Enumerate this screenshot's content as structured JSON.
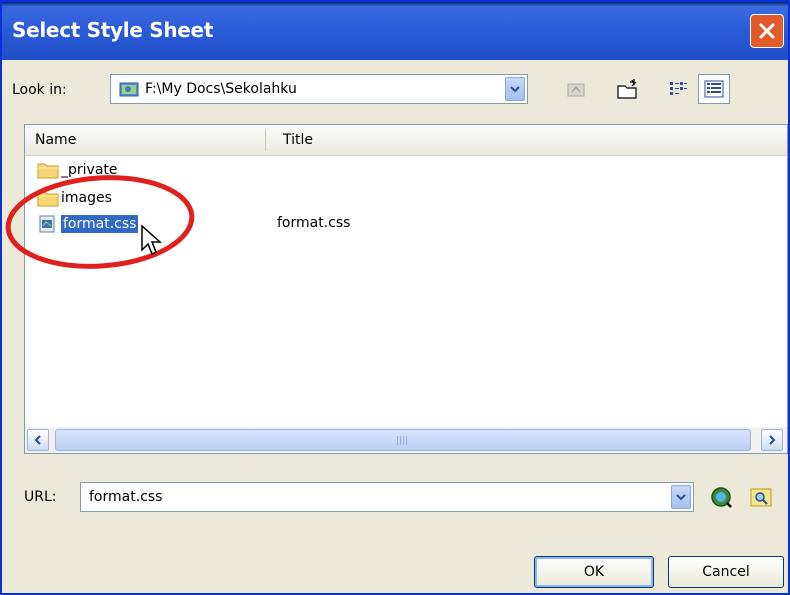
{
  "window": {
    "title": "Select Style Sheet"
  },
  "lookin": {
    "label": "Look in:",
    "path": "F:\\My Docs\\Sekolahku"
  },
  "list": {
    "col_name": "Name",
    "col_title": "Title",
    "items": [
      {
        "name": "_private",
        "title": "",
        "icon": "folder-icon"
      },
      {
        "name": "images",
        "title": "",
        "icon": "folder-icon"
      },
      {
        "name": "format.css",
        "title": "format.css",
        "icon": "css-file-icon",
        "selected": true
      }
    ]
  },
  "url": {
    "label": "URL:",
    "value": "format.css"
  },
  "buttons": {
    "ok": "OK",
    "cancel": "Cancel"
  },
  "colors": {
    "titlebar": "#2a5bd7",
    "selection": "#316ac5",
    "annotation": "#e0201c",
    "dialog_bg": "#ece9d8"
  }
}
